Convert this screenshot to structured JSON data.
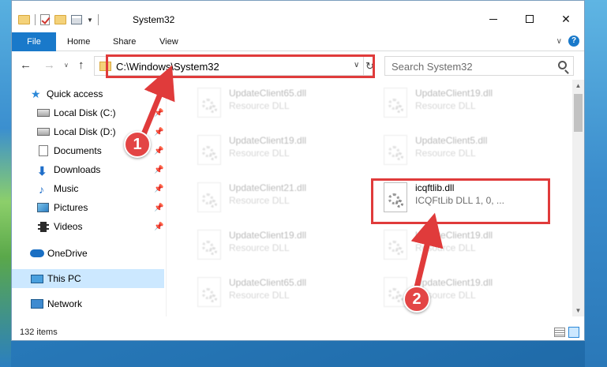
{
  "window": {
    "title": "System32",
    "controls": {
      "minimize": "minimize",
      "maximize": "maximize",
      "close": "✕"
    }
  },
  "ribbon": {
    "tabs": [
      "File",
      "Home",
      "Share",
      "View"
    ],
    "help": "?"
  },
  "nav": {
    "address": "C:\\Windows\\System32",
    "search_placeholder": "Search System32"
  },
  "sidebar": {
    "items": [
      {
        "label": "Quick access",
        "icon": "star-icon",
        "pinned": false
      },
      {
        "label": "Local Disk (C:)",
        "icon": "drive-icon",
        "pinned": true
      },
      {
        "label": "Local Disk (D:)",
        "icon": "drive-icon",
        "pinned": true
      },
      {
        "label": "Documents",
        "icon": "documents-icon",
        "pinned": true
      },
      {
        "label": "Downloads",
        "icon": "download-icon",
        "pinned": true
      },
      {
        "label": "Music",
        "icon": "music-icon",
        "pinned": true
      },
      {
        "label": "Pictures",
        "icon": "pictures-icon",
        "pinned": true
      },
      {
        "label": "Videos",
        "icon": "videos-icon",
        "pinned": true
      },
      {
        "label": "OneDrive",
        "icon": "onedrive-icon",
        "pinned": false
      },
      {
        "label": "This PC",
        "icon": "this-pc-icon",
        "pinned": false,
        "selected": true
      },
      {
        "label": "Network",
        "icon": "network-icon",
        "pinned": false
      }
    ]
  },
  "files": {
    "left_column": [
      {
        "name": "UpdateClient65.dll",
        "desc": "Resource DLL"
      },
      {
        "name": "UpdateClient19.dll",
        "desc": "Resource DLL"
      },
      {
        "name": "UpdateClient21.dll",
        "desc": "Resource DLL"
      },
      {
        "name": "UpdateClient19.dll",
        "desc": "Resource DLL"
      },
      {
        "name": "UpdateClient65.dll",
        "desc": "Resource DLL"
      }
    ],
    "right_column": [
      {
        "name": "UpdateClient19.dll",
        "desc": "Resource DLL"
      },
      {
        "name": "UpdateClient5.dll",
        "desc": "Resource DLL"
      },
      {
        "name": "icqftlib.dll",
        "desc": "ICQFtLib DLL 1, 0, ...",
        "highlighted": true
      },
      {
        "name": "UpdateClient19.dll",
        "desc": "Resource DLL"
      },
      {
        "name": "UpdateClient19.dll",
        "desc": "Resource DLL"
      }
    ]
  },
  "status": {
    "item_count": "132 items"
  },
  "annotations": {
    "step1": "1",
    "step2": "2",
    "color": "#e03b3b"
  }
}
